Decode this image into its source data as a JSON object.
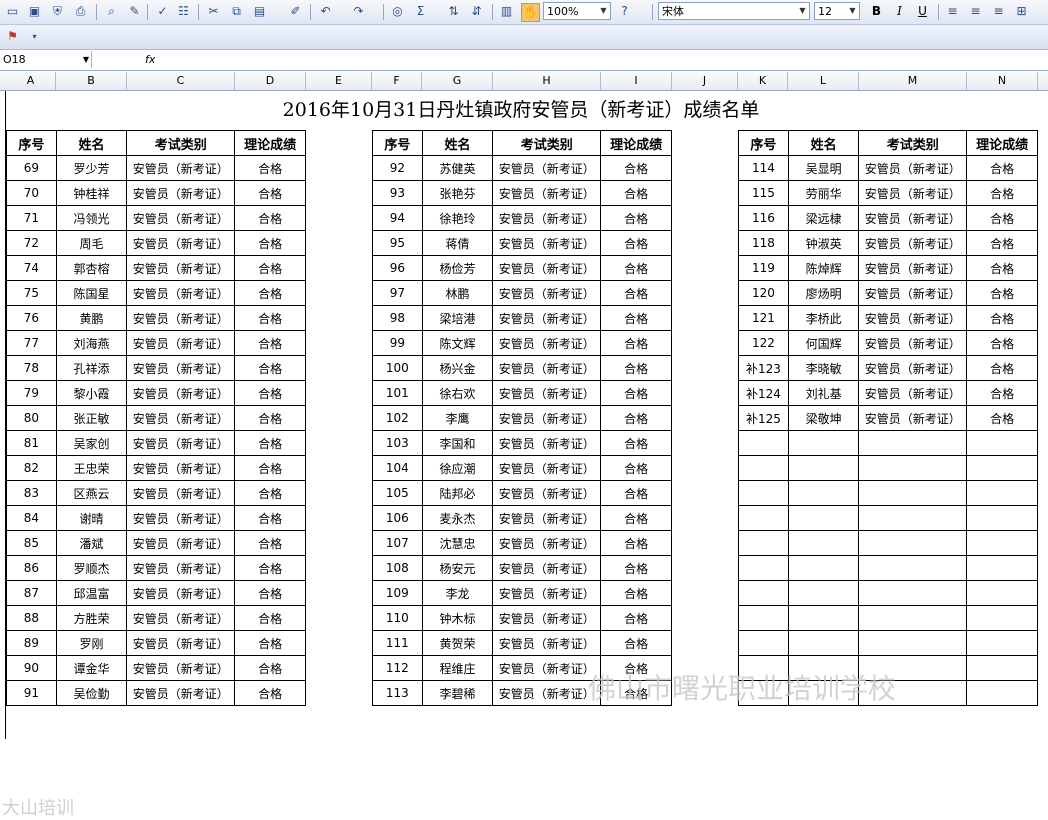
{
  "toolbar": {
    "zoom": "100%",
    "font": "宋体",
    "size": "12",
    "bold": "B",
    "italic": "I",
    "underline": "U",
    "sigma": "Σ"
  },
  "formula": {
    "cell": "O18",
    "fx": "fx"
  },
  "columns": [
    "A",
    "B",
    "C",
    "D",
    "E",
    "F",
    "G",
    "H",
    "I",
    "J",
    "K",
    "L",
    "M",
    "N"
  ],
  "title": "2016年10月31日丹灶镇政府安管员（新考证）成绩名单",
  "headers": [
    "序号",
    "姓名",
    "考试类别",
    "理论成绩"
  ],
  "exam_type": "安管员（新考证）",
  "result": "合格",
  "block1": [
    [
      "69",
      "罗少芳"
    ],
    [
      "70",
      "钟桂祥"
    ],
    [
      "71",
      "冯领光"
    ],
    [
      "72",
      "周毛"
    ],
    [
      "74",
      "郭杏榕"
    ],
    [
      "75",
      "陈国星"
    ],
    [
      "76",
      "黄鹏"
    ],
    [
      "77",
      "刘海燕"
    ],
    [
      "78",
      "孔祥添"
    ],
    [
      "79",
      "黎小霞"
    ],
    [
      "80",
      "张正敏"
    ],
    [
      "81",
      "吴家创"
    ],
    [
      "82",
      "王忠荣"
    ],
    [
      "83",
      "区燕云"
    ],
    [
      "84",
      "谢晴"
    ],
    [
      "85",
      "潘斌"
    ],
    [
      "86",
      "罗顺杰"
    ],
    [
      "87",
      "邱温富"
    ],
    [
      "88",
      "方胜荣"
    ],
    [
      "89",
      "罗刚"
    ],
    [
      "90",
      "谭金华"
    ],
    [
      "91",
      "吴俭勤"
    ]
  ],
  "block2": [
    [
      "92",
      "苏健英"
    ],
    [
      "93",
      "张艳芬"
    ],
    [
      "94",
      "徐艳玲"
    ],
    [
      "95",
      "蒋倩"
    ],
    [
      "96",
      "杨俭芳"
    ],
    [
      "97",
      "林鹏"
    ],
    [
      "98",
      "梁培港"
    ],
    [
      "99",
      "陈文辉"
    ],
    [
      "100",
      "杨兴金"
    ],
    [
      "101",
      "徐右欢"
    ],
    [
      "102",
      "李鹰"
    ],
    [
      "103",
      "李国和"
    ],
    [
      "104",
      "徐应潮"
    ],
    [
      "105",
      "陆邦必"
    ],
    [
      "106",
      "麦永杰"
    ],
    [
      "107",
      "沈慧忠"
    ],
    [
      "108",
      "杨安元"
    ],
    [
      "109",
      "李龙"
    ],
    [
      "110",
      "钟木标"
    ],
    [
      "111",
      "黄贺荣"
    ],
    [
      "112",
      "程维庄"
    ],
    [
      "113",
      "李碧稀"
    ]
  ],
  "block3": [
    [
      "114",
      "吴显明"
    ],
    [
      "115",
      "劳丽华"
    ],
    [
      "116",
      "梁远棣"
    ],
    [
      "118",
      "钟淑英"
    ],
    [
      "119",
      "陈焯辉"
    ],
    [
      "120",
      "廖炀明"
    ],
    [
      "121",
      "李桥此"
    ],
    [
      "122",
      "何国辉"
    ],
    [
      "补123",
      "李晓敏"
    ],
    [
      "补124",
      "刘礼基"
    ],
    [
      "补125",
      "梁敬坤"
    ]
  ],
  "watermark": "佛山市曙光职业培训学校",
  "watermark_left": "大山培训"
}
